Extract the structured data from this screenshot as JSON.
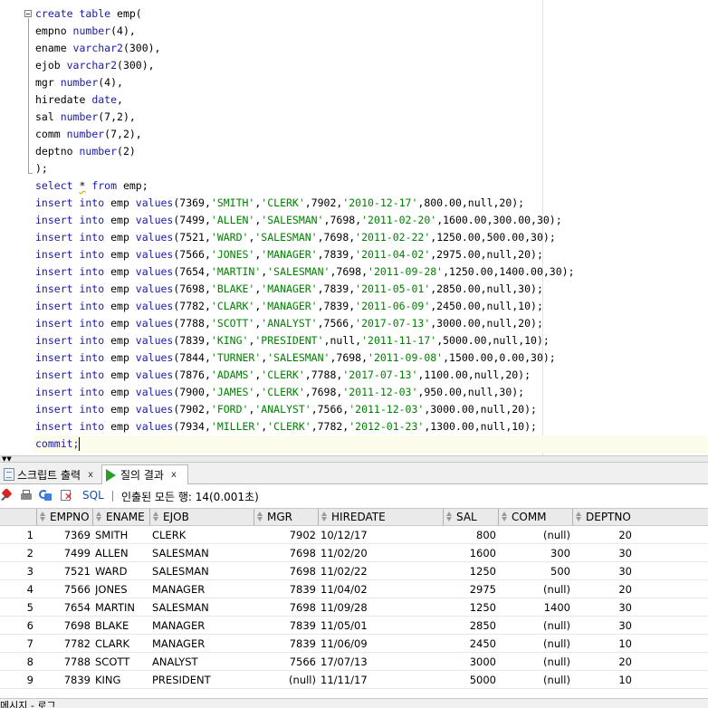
{
  "editor": {
    "lines": [
      [
        {
          "t": "create table ",
          "c": "kw"
        },
        {
          "t": "emp(",
          "c": ""
        }
      ],
      [
        {
          "t": "empno ",
          "c": ""
        },
        {
          "t": "number",
          "c": "kw"
        },
        {
          "t": "(4),",
          "c": ""
        }
      ],
      [
        {
          "t": "ename ",
          "c": ""
        },
        {
          "t": "varchar2",
          "c": "kw"
        },
        {
          "t": "(300),",
          "c": ""
        }
      ],
      [
        {
          "t": "ejob ",
          "c": ""
        },
        {
          "t": "varchar2",
          "c": "kw"
        },
        {
          "t": "(300),",
          "c": ""
        }
      ],
      [
        {
          "t": "mgr ",
          "c": ""
        },
        {
          "t": "number",
          "c": "kw"
        },
        {
          "t": "(4),",
          "c": ""
        }
      ],
      [
        {
          "t": "hiredate ",
          "c": ""
        },
        {
          "t": "date",
          "c": "kw"
        },
        {
          "t": ",",
          "c": ""
        }
      ],
      [
        {
          "t": "sal ",
          "c": ""
        },
        {
          "t": "number",
          "c": "kw"
        },
        {
          "t": "(7,2),",
          "c": ""
        }
      ],
      [
        {
          "t": "comm ",
          "c": ""
        },
        {
          "t": "number",
          "c": "kw"
        },
        {
          "t": "(7,2),",
          "c": ""
        }
      ],
      [
        {
          "t": "deptno ",
          "c": ""
        },
        {
          "t": "number",
          "c": "kw"
        },
        {
          "t": "(2)",
          "c": ""
        }
      ],
      [
        {
          "t": ");",
          "c": ""
        }
      ],
      [
        {
          "t": "select ",
          "c": "kw"
        },
        {
          "t": "*",
          "c": "squiggle"
        },
        {
          "t": " from ",
          "c": "kw"
        },
        {
          "t": "emp;",
          "c": ""
        }
      ],
      [
        {
          "t": "insert into ",
          "c": "kw"
        },
        {
          "t": "emp ",
          "c": ""
        },
        {
          "t": "values",
          "c": "kw"
        },
        {
          "t": "(7369,",
          "c": ""
        },
        {
          "t": "'SMITH'",
          "c": "str"
        },
        {
          "t": ",",
          "c": ""
        },
        {
          "t": "'CLERK'",
          "c": "str"
        },
        {
          "t": ",7902,",
          "c": ""
        },
        {
          "t": "'2010-12-17'",
          "c": "str"
        },
        {
          "t": ",800.00,null,20);",
          "c": ""
        }
      ],
      [
        {
          "t": "insert into ",
          "c": "kw"
        },
        {
          "t": "emp ",
          "c": ""
        },
        {
          "t": "values",
          "c": "kw"
        },
        {
          "t": "(7499,",
          "c": ""
        },
        {
          "t": "'ALLEN'",
          "c": "str"
        },
        {
          "t": ",",
          "c": ""
        },
        {
          "t": "'SALESMAN'",
          "c": "str"
        },
        {
          "t": ",7698,",
          "c": ""
        },
        {
          "t": "'2011-02-20'",
          "c": "str"
        },
        {
          "t": ",1600.00,300.00,30);",
          "c": ""
        }
      ],
      [
        {
          "t": "insert into ",
          "c": "kw"
        },
        {
          "t": "emp ",
          "c": ""
        },
        {
          "t": "values",
          "c": "kw"
        },
        {
          "t": "(7521,",
          "c": ""
        },
        {
          "t": "'WARD'",
          "c": "str"
        },
        {
          "t": ",",
          "c": ""
        },
        {
          "t": "'SALESMAN'",
          "c": "str"
        },
        {
          "t": ",7698,",
          "c": ""
        },
        {
          "t": "'2011-02-22'",
          "c": "str"
        },
        {
          "t": ",1250.00,500.00,30);",
          "c": ""
        }
      ],
      [
        {
          "t": "insert into ",
          "c": "kw"
        },
        {
          "t": "emp ",
          "c": ""
        },
        {
          "t": "values",
          "c": "kw"
        },
        {
          "t": "(7566,",
          "c": ""
        },
        {
          "t": "'JONES'",
          "c": "str"
        },
        {
          "t": ",",
          "c": ""
        },
        {
          "t": "'MANAGER'",
          "c": "str"
        },
        {
          "t": ",7839,",
          "c": ""
        },
        {
          "t": "'2011-04-02'",
          "c": "str"
        },
        {
          "t": ",2975.00,null,20);",
          "c": ""
        }
      ],
      [
        {
          "t": "insert into ",
          "c": "kw"
        },
        {
          "t": "emp ",
          "c": ""
        },
        {
          "t": "values",
          "c": "kw"
        },
        {
          "t": "(7654,",
          "c": ""
        },
        {
          "t": "'MARTIN'",
          "c": "str"
        },
        {
          "t": ",",
          "c": ""
        },
        {
          "t": "'SALESMAN'",
          "c": "str"
        },
        {
          "t": ",7698,",
          "c": ""
        },
        {
          "t": "'2011-09-28'",
          "c": "str"
        },
        {
          "t": ",1250.00,1400.00,30);",
          "c": ""
        }
      ],
      [
        {
          "t": "insert into ",
          "c": "kw"
        },
        {
          "t": "emp ",
          "c": ""
        },
        {
          "t": "values",
          "c": "kw"
        },
        {
          "t": "(7698,",
          "c": ""
        },
        {
          "t": "'BLAKE'",
          "c": "str"
        },
        {
          "t": ",",
          "c": ""
        },
        {
          "t": "'MANAGER'",
          "c": "str"
        },
        {
          "t": ",7839,",
          "c": ""
        },
        {
          "t": "'2011-05-01'",
          "c": "str"
        },
        {
          "t": ",2850.00,null,30);",
          "c": ""
        }
      ],
      [
        {
          "t": "insert into ",
          "c": "kw"
        },
        {
          "t": "emp ",
          "c": ""
        },
        {
          "t": "values",
          "c": "kw"
        },
        {
          "t": "(7782,",
          "c": ""
        },
        {
          "t": "'CLARK'",
          "c": "str"
        },
        {
          "t": ",",
          "c": ""
        },
        {
          "t": "'MANAGER'",
          "c": "str"
        },
        {
          "t": ",7839,",
          "c": ""
        },
        {
          "t": "'2011-06-09'",
          "c": "str"
        },
        {
          "t": ",2450.00,null,10);",
          "c": ""
        }
      ],
      [
        {
          "t": "insert into ",
          "c": "kw"
        },
        {
          "t": "emp ",
          "c": ""
        },
        {
          "t": "values",
          "c": "kw"
        },
        {
          "t": "(7788,",
          "c": ""
        },
        {
          "t": "'SCOTT'",
          "c": "str"
        },
        {
          "t": ",",
          "c": ""
        },
        {
          "t": "'ANALYST'",
          "c": "str"
        },
        {
          "t": ",7566,",
          "c": ""
        },
        {
          "t": "'2017-07-13'",
          "c": "str"
        },
        {
          "t": ",3000.00,null,20);",
          "c": ""
        }
      ],
      [
        {
          "t": "insert into ",
          "c": "kw"
        },
        {
          "t": "emp ",
          "c": ""
        },
        {
          "t": "values",
          "c": "kw"
        },
        {
          "t": "(7839,",
          "c": ""
        },
        {
          "t": "'KING'",
          "c": "str"
        },
        {
          "t": ",",
          "c": ""
        },
        {
          "t": "'PRESIDENT'",
          "c": "str"
        },
        {
          "t": ",null,",
          "c": ""
        },
        {
          "t": "'2011-11-17'",
          "c": "str"
        },
        {
          "t": ",5000.00,null,10);",
          "c": ""
        }
      ],
      [
        {
          "t": "insert into ",
          "c": "kw"
        },
        {
          "t": "emp ",
          "c": ""
        },
        {
          "t": "values",
          "c": "kw"
        },
        {
          "t": "(7844,",
          "c": ""
        },
        {
          "t": "'TURNER'",
          "c": "str"
        },
        {
          "t": ",",
          "c": ""
        },
        {
          "t": "'SALESMAN'",
          "c": "str"
        },
        {
          "t": ",7698,",
          "c": ""
        },
        {
          "t": "'2011-09-08'",
          "c": "str"
        },
        {
          "t": ",1500.00,0.00,30);",
          "c": ""
        }
      ],
      [
        {
          "t": "insert into ",
          "c": "kw"
        },
        {
          "t": "emp ",
          "c": ""
        },
        {
          "t": "values",
          "c": "kw"
        },
        {
          "t": "(7876,",
          "c": ""
        },
        {
          "t": "'ADAMS'",
          "c": "str"
        },
        {
          "t": ",",
          "c": ""
        },
        {
          "t": "'CLERK'",
          "c": "str"
        },
        {
          "t": ",7788,",
          "c": ""
        },
        {
          "t": "'2017-07-13'",
          "c": "str"
        },
        {
          "t": ",1100.00,null,20);",
          "c": ""
        }
      ],
      [
        {
          "t": "insert into ",
          "c": "kw"
        },
        {
          "t": "emp ",
          "c": ""
        },
        {
          "t": "values",
          "c": "kw"
        },
        {
          "t": "(7900,",
          "c": ""
        },
        {
          "t": "'JAMES'",
          "c": "str"
        },
        {
          "t": ",",
          "c": ""
        },
        {
          "t": "'CLERK'",
          "c": "str"
        },
        {
          "t": ",7698,",
          "c": ""
        },
        {
          "t": "'2011-12-03'",
          "c": "str"
        },
        {
          "t": ",950.00,null,30);",
          "c": ""
        }
      ],
      [
        {
          "t": "insert into ",
          "c": "kw"
        },
        {
          "t": "emp ",
          "c": ""
        },
        {
          "t": "values",
          "c": "kw"
        },
        {
          "t": "(7902,",
          "c": ""
        },
        {
          "t": "'FORD'",
          "c": "str"
        },
        {
          "t": ",",
          "c": ""
        },
        {
          "t": "'ANALYST'",
          "c": "str"
        },
        {
          "t": ",7566,",
          "c": ""
        },
        {
          "t": "'2011-12-03'",
          "c": "str"
        },
        {
          "t": ",3000.00,null,20);",
          "c": ""
        }
      ],
      [
        {
          "t": "insert into ",
          "c": "kw"
        },
        {
          "t": "emp ",
          "c": ""
        },
        {
          "t": "values",
          "c": "kw"
        },
        {
          "t": "(7934,",
          "c": ""
        },
        {
          "t": "'MILLER'",
          "c": "str"
        },
        {
          "t": ",",
          "c": ""
        },
        {
          "t": "'CLERK'",
          "c": "str"
        },
        {
          "t": ",7782,",
          "c": ""
        },
        {
          "t": "'2012-01-23'",
          "c": "str"
        },
        {
          "t": ",1300.00,null,10);",
          "c": ""
        }
      ],
      [
        {
          "t": "commit;",
          "c": "kw"
        }
      ]
    ]
  },
  "tabs": {
    "script_output": "스크립트 출력",
    "query_result": "질의 결과",
    "close_glyph": "x"
  },
  "toolbar": {
    "sql_label": "SQL",
    "separator": "|",
    "fetch_status": "인출된 모든 행: 14(0.001초)"
  },
  "grid": {
    "columns": [
      "EMPNO",
      "ENAME",
      "EJOB",
      "MGR",
      "HIREDATE",
      "SAL",
      "COMM",
      "DEPTNO"
    ],
    "rows": [
      [
        "1",
        "7369",
        "SMITH",
        "CLERK",
        "7902",
        "10/12/17",
        "800",
        "(null)",
        "20"
      ],
      [
        "2",
        "7499",
        "ALLEN",
        "SALESMAN",
        "7698",
        "11/02/20",
        "1600",
        "300",
        "30"
      ],
      [
        "3",
        "7521",
        "WARD",
        "SALESMAN",
        "7698",
        "11/02/22",
        "1250",
        "500",
        "30"
      ],
      [
        "4",
        "7566",
        "JONES",
        "MANAGER",
        "7839",
        "11/04/02",
        "2975",
        "(null)",
        "20"
      ],
      [
        "5",
        "7654",
        "MARTIN",
        "SALESMAN",
        "7698",
        "11/09/28",
        "1250",
        "1400",
        "30"
      ],
      [
        "6",
        "7698",
        "BLAKE",
        "MANAGER",
        "7839",
        "11/05/01",
        "2850",
        "(null)",
        "30"
      ],
      [
        "7",
        "7782",
        "CLARK",
        "MANAGER",
        "7839",
        "11/06/09",
        "2450",
        "(null)",
        "10"
      ],
      [
        "8",
        "7788",
        "SCOTT",
        "ANALYST",
        "7566",
        "17/07/13",
        "3000",
        "(null)",
        "20"
      ],
      [
        "9",
        "7839",
        "KING",
        "PRESIDENT",
        "(null)",
        "11/11/17",
        "5000",
        "(null)",
        "10"
      ]
    ]
  },
  "bottom": {
    "label": "메시지 - 로그"
  },
  "colors": {
    "keyword": "#1a1aa6",
    "string": "#008000",
    "current_line": "#fdfcea"
  }
}
